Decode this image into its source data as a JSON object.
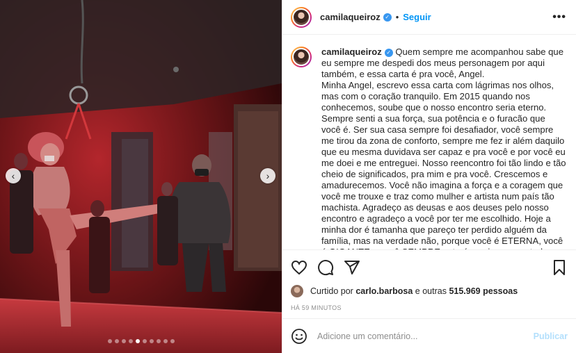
{
  "post": {
    "username": "camilaqueiroz",
    "follow_label": "Seguir",
    "separator": "•",
    "more_icon": "more-options-icon"
  },
  "caption": {
    "username": "camilaqueiroz",
    "paragraphs": [
      "Quem sempre me acompanhou sabe que eu sempre me despedi dos meus personagem por aqui também, e essa carta é pra você, Angel.",
      "Minha Angel, escrevo essa carta com lágrimas nos olhos, mas com o coração tranquilo. Em 2015 quando nos conhecemos, soube que o nosso encontro seria eterno. Sempre senti a sua força, sua potência e o furacão que você é. Ser sua casa sempre foi desafiador, você sempre me tirou da zona de conforto, sempre me fez ir além daquilo que eu mesma duvidava ser capaz e pra você e por você eu me doei e me entreguei. Nosso reencontro foi tão lindo e tão cheio de significados, pra mim e pra você. Crescemos e amadurecemos. Você não imagina a força e a coragem que você me trouxe e traz como mulher e artista num país tão machista. Agradeço as deusas e aos deuses pelo nosso encontro e agradeço a você por ter me escolhido. Hoje a minha dor é tamanha que pareço ter perdido alguém da família, mas na verdade não, porque você é ETERNA, você é GIGANTE e você SEMPRE estará comigo e com todos que viveram com a gente a sua história. Desculpa não ter me despedido de você como você merecia, não me permitiram, mas no meu coração e na"
    ]
  },
  "actions": {
    "icons": [
      "heart-icon",
      "comment-icon",
      "share-icon",
      "bookmark-icon"
    ]
  },
  "likes": {
    "prefix": "Curtido por",
    "user": "carlo.barbosa",
    "middle": "e outras",
    "count": "515.969 pessoas"
  },
  "timestamp": "HÁ 59 MINUTOS",
  "comment": {
    "placeholder": "Adicione um comentário...",
    "publish_label": "Publicar",
    "emoji_icon": "emoji-icon"
  },
  "carousel": {
    "prev_icon": "chevron-left-icon",
    "next_icon": "chevron-right-icon",
    "total_slides": 10,
    "active_slide": 4
  },
  "colors": {
    "accent": "#0095f6",
    "verified": "#3897f0",
    "publish_disabled": "#b2dffc",
    "muted": "#8e8e8e"
  }
}
